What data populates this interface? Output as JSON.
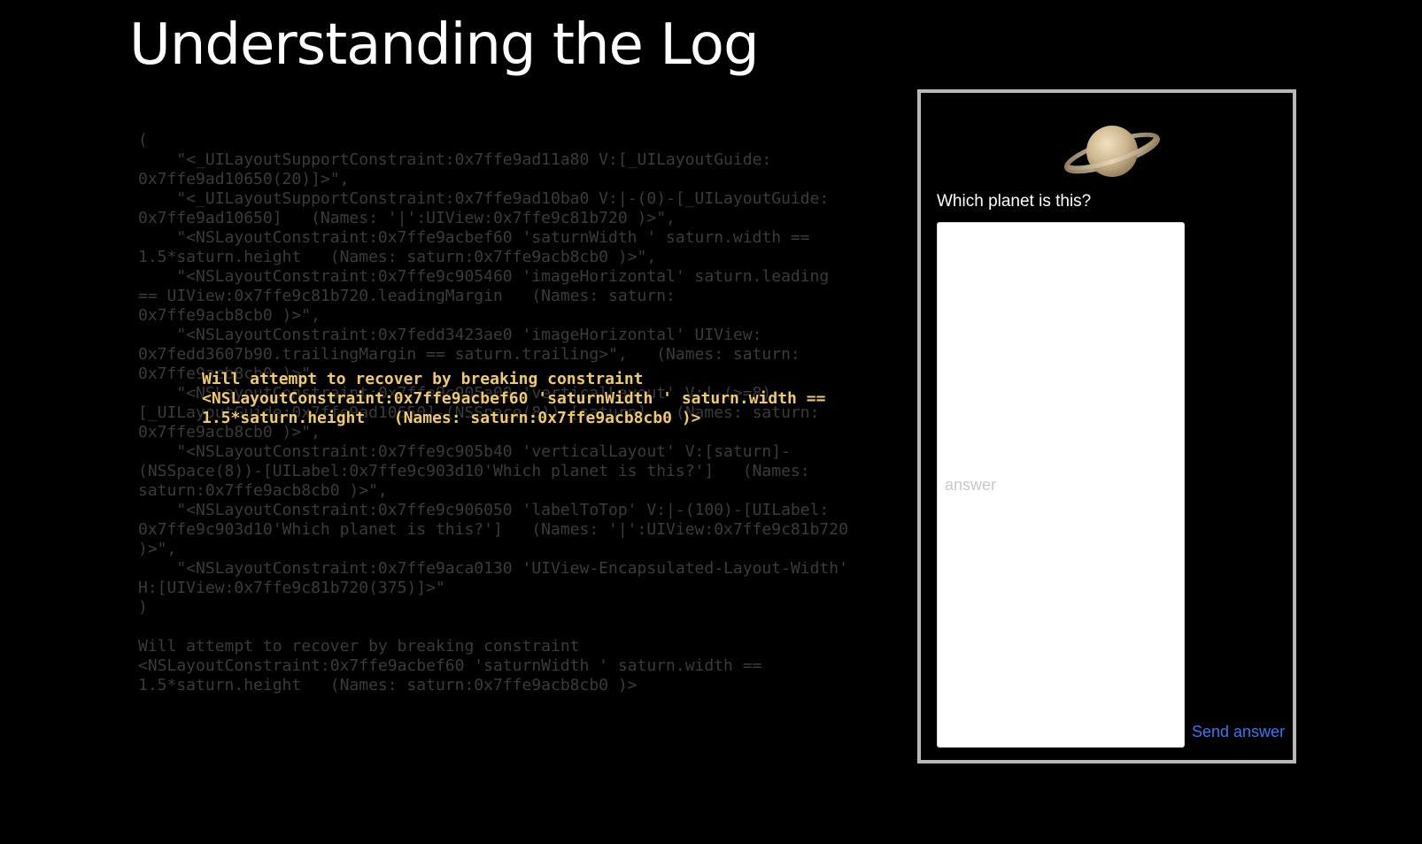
{
  "slide": {
    "title": "Understanding the Log"
  },
  "log": {
    "full_text": "(\n    \"<_UILayoutSupportConstraint:0x7ffe9ad11a80 V:[_UILayoutGuide:\n0x7ffe9ad10650(20)]>\",\n    \"<_UILayoutSupportConstraint:0x7ffe9ad10ba0 V:|-(0)-[_UILayoutGuide:\n0x7ffe9ad10650]   (Names: '|':UIView:0x7ffe9c81b720 )>\",\n    \"<NSLayoutConstraint:0x7ffe9acbef60 'saturnWidth ' saturn.width ==\n1.5*saturn.height   (Names: saturn:0x7ffe9acb8cb0 )>\",\n    \"<NSLayoutConstraint:0x7ffe9c905460 'imageHorizontal' saturn.leading\n== UIView:0x7ffe9c81b720.leadingMargin   (Names: saturn:\n0x7ffe9acb8cb0 )>\",\n    \"<NSLayoutConstraint:0x7fedd3423ae0 'imageHorizontal' UIView:\n0x7fedd3607b90.trailingMargin == saturn.trailing>\",   (Names: saturn:\n0x7ffe9acb8cb0 )>\",\n    \"<NSLayoutConstraint:0x7ffe9c905a00 'verticalLayout' V:|-(>=8)-\n[_UILayoutGuide:0x7ffe9ad10650]-(NSSpace(8))-[saturn]   (Names: saturn:\n0x7ffe9acb8cb0 )>\",\n    \"<NSLayoutConstraint:0x7ffe9c905b40 'verticalLayout' V:[saturn]-\n(NSSpace(8))-[UILabel:0x7ffe9c903d10'Which planet is this?']   (Names:\nsaturn:0x7ffe9acb8cb0 )>\",\n    \"<NSLayoutConstraint:0x7ffe9c906050 'labelToTop' V:|-(100)-[UILabel:\n0x7ffe9c903d10'Which planet is this?']   (Names: '|':UIView:0x7ffe9c81b720\n)>\",\n    \"<NSLayoutConstraint:0x7ffe9aca0130 'UIView-Encapsulated-Layout-Width'\nH:[UIView:0x7ffe9c81b720(375)]>\"\n)\n\nWill attempt to recover by breaking constraint\n<NSLayoutConstraint:0x7ffe9acbef60 'saturnWidth ' saturn.width ==\n1.5*saturn.height   (Names: saturn:0x7ffe9acb8cb0 )>",
    "highlight_text": "Will attempt to recover by breaking constraint\n<NSLayoutConstraint:0x7ffe9acbef60 'saturnWidth ' saturn.width ==\n1.5*saturn.height   (Names: saturn:0x7ffe9acb8cb0 )>"
  },
  "phone": {
    "image_icon": "saturn-planet-icon",
    "question_label": "Which planet is this?",
    "answer_placeholder": "answer",
    "answer_value": "",
    "send_button_label": "Send answer"
  },
  "colors": {
    "background": "#000000",
    "dim_log_text": "#3b3b3b",
    "highlight_text": "#f0c96a",
    "phone_border": "#b9b9b9",
    "button_blue": "#3478f6",
    "placeholder": "#c7c7cd"
  }
}
